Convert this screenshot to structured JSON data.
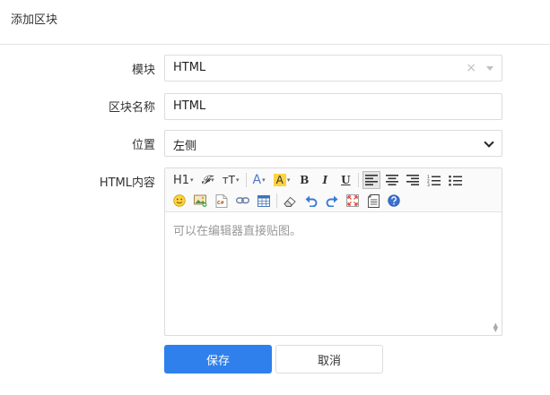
{
  "dialog": {
    "title": "添加区块"
  },
  "form": {
    "module": {
      "label": "模块",
      "value": "HTML",
      "clear_glyph": "×"
    },
    "block_name": {
      "label": "区块名称",
      "value": "HTML"
    },
    "position": {
      "label": "位置",
      "value": "左侧"
    },
    "html_content": {
      "label": "HTML内容",
      "placeholder": "可以在编辑器直接贴图。"
    }
  },
  "toolbar": {
    "heading": "H1",
    "font_family": "𝓕",
    "font_size": "тT",
    "font_color": "A",
    "bg_color": "A",
    "bold": "B",
    "italic": "I",
    "underline": "U",
    "code": "C#",
    "dropdown_glyph": "▾"
  },
  "colors": {
    "primary": "#2f80ed",
    "font_color": "#4a7bd0",
    "bg_highlight": "#ffd23f"
  },
  "actions": {
    "save": "保存",
    "cancel": "取消"
  }
}
